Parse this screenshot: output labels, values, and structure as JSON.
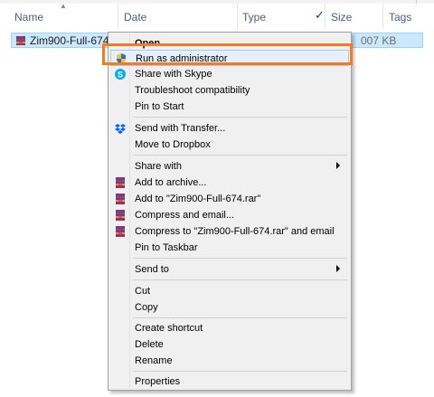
{
  "columns": {
    "name": "Name",
    "date": "Date",
    "type": "Type",
    "size": "Size",
    "tags": "Tags"
  },
  "file": {
    "name": "Zim900-Full-674",
    "size": "007 KB"
  },
  "menu": {
    "open": "Open",
    "run_as_admin": "Run as administrator",
    "share_skype": "Share with Skype",
    "troubleshoot": "Troubleshoot compatibility",
    "pin_start": "Pin to Start",
    "send_transfer": "Send with Transfer...",
    "move_dropbox": "Move to Dropbox",
    "share_with": "Share with",
    "add_archive": "Add to archive...",
    "add_rar": "Add to \"Zim900-Full-674.rar\"",
    "compress_email": "Compress and email...",
    "compress_rar_email": "Compress to \"Zim900-Full-674.rar\" and email",
    "pin_taskbar": "Pin to Taskbar",
    "send_to": "Send to",
    "cut": "Cut",
    "copy": "Copy",
    "create_shortcut": "Create shortcut",
    "delete": "Delete",
    "rename": "Rename",
    "properties": "Properties"
  },
  "colors": {
    "highlight_outline": "#f57b20",
    "selection": "#cce8ff"
  }
}
